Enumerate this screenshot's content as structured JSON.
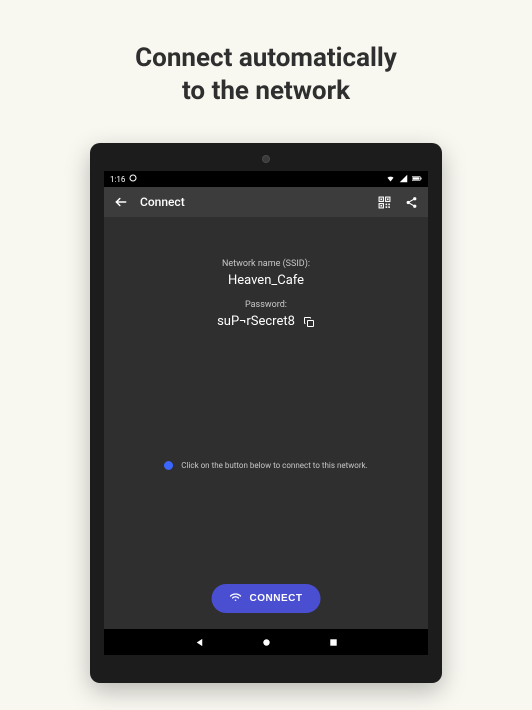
{
  "marketing": {
    "line1": "Connect automatically",
    "line2": "to the network"
  },
  "status_bar": {
    "time": "1:16"
  },
  "title_bar": {
    "title": "Connect"
  },
  "network": {
    "ssid_label": "Network name (SSID):",
    "ssid_value": "Heaven_Cafe",
    "password_label": "Password:",
    "password_value": "suP¬rSecret8"
  },
  "hint": {
    "text": "Click on the button below to connect to this network."
  },
  "connect_button": {
    "label": "CONNECT"
  }
}
